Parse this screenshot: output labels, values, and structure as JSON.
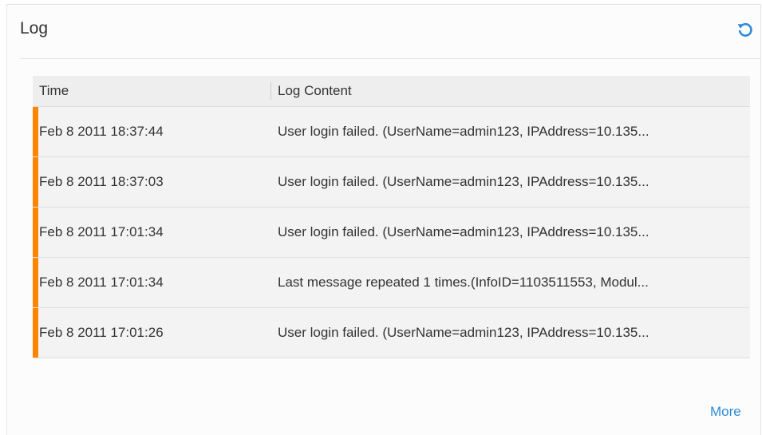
{
  "panel": {
    "title": "Log",
    "refresh_icon": "refresh-icon",
    "more_label": "More"
  },
  "table": {
    "columns": [
      "Time",
      "Log Content"
    ],
    "rows": [
      {
        "time": "Feb 8 2011 18:37:44",
        "content": "User login failed. (UserName=admin123, IPAddress=10.135..."
      },
      {
        "time": "Feb 8 2011 18:37:03",
        "content": "User login failed. (UserName=admin123, IPAddress=10.135..."
      },
      {
        "time": "Feb 8 2011 17:01:34",
        "content": "User login failed. (UserName=admin123, IPAddress=10.135..."
      },
      {
        "time": "Feb 8 2011 17:01:34",
        "content": "Last message repeated 1 times.(InfoID=1103511553, Modul..."
      },
      {
        "time": "Feb 8 2011 17:01:26",
        "content": "User login failed. (UserName=admin123, IPAddress=10.135..."
      }
    ]
  },
  "colors": {
    "accent": "#ff8400",
    "link": "#2e8bd8"
  }
}
